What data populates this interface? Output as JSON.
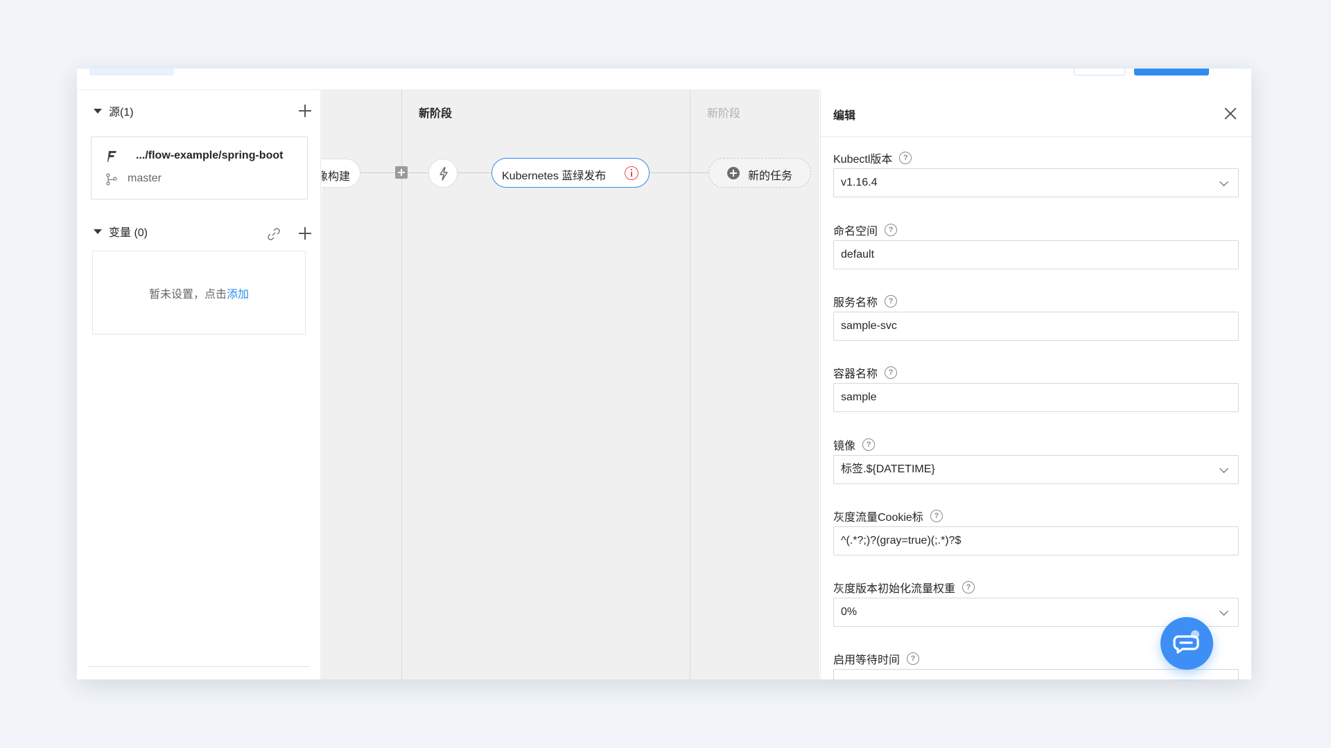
{
  "sidebar": {
    "source_title": "源(1)",
    "repo_name": ".../flow-example/spring-boot",
    "branch": "master",
    "variables_title": "变量 (0)",
    "empty_text": "暂未设置，点击 ",
    "empty_link": "添加"
  },
  "canvas": {
    "partial_node_label": "像构建",
    "stage1_title": "新阶段",
    "stage2_title": "新阶段",
    "task_label": "Kubernetes 蓝绿发布",
    "new_task_label": "新的任务"
  },
  "panel": {
    "title": "编辑",
    "fields": [
      {
        "label": "Kubectl版本",
        "value": "v1.16.4",
        "type": "select"
      },
      {
        "label": "命名空间",
        "value": "default",
        "type": "input"
      },
      {
        "label": "服务名称",
        "value": "sample-svc",
        "type": "input"
      },
      {
        "label": "容器名称",
        "value": "sample",
        "type": "input"
      },
      {
        "label": "镜像",
        "value": "标签.${DATETIME}",
        "type": "select"
      },
      {
        "label": "灰度流量Cookie标",
        "value": "^(.*?;)?(gray=true)(;.*)?$",
        "type": "input"
      },
      {
        "label": "灰度版本初始化流量权重",
        "value": "0%",
        "type": "select"
      },
      {
        "label": "启用等待时间",
        "value": "",
        "type": "input"
      }
    ]
  },
  "colors": {
    "accent": "#2f8cf0",
    "error": "#e64c4c",
    "canvas_bg": "#f0f0f0",
    "page_bg": "#f1f5f9"
  }
}
